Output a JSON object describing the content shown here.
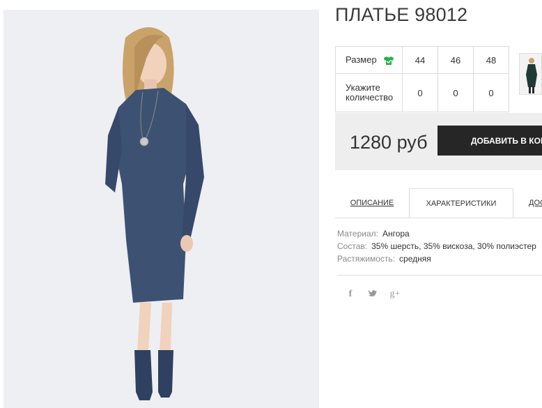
{
  "product": {
    "title": "ПЛАТЬЕ 98012",
    "photo_icon": "model-photo",
    "thumbnail_icon": "model-thumbnail"
  },
  "sizes": {
    "size_label": "Размер",
    "size_icon": "tshirt-icon",
    "qty_label_line1": "Укажите",
    "qty_label_line2": "количество",
    "values": [
      "44",
      "46",
      "48"
    ],
    "quantities": [
      "0",
      "0",
      "0"
    ]
  },
  "purchase": {
    "price": "1280 руб",
    "add_to_cart": "ДОБАВИТЬ В КОРЗИНУ",
    "cart_icon": "shopping-bag-icon"
  },
  "tabs": [
    {
      "label": "Описание"
    },
    {
      "label": "Характеристики"
    },
    {
      "label": "Доставка"
    }
  ],
  "specs": [
    {
      "key": "Материал:",
      "value": "Ангора"
    },
    {
      "key": "Состав:",
      "value": "35% шерсть, 35% вискоза, 30% полиэстер"
    },
    {
      "key": "Растяжимость:",
      "value": "средняя"
    }
  ],
  "social": {
    "facebook": "f",
    "twitter": "twitter-icon",
    "google_plus": "g+"
  },
  "colors": {
    "dress": "#3d5272",
    "button": "#262626",
    "price_bg": "#eeeeee",
    "size_icon": "#1fb24a"
  }
}
